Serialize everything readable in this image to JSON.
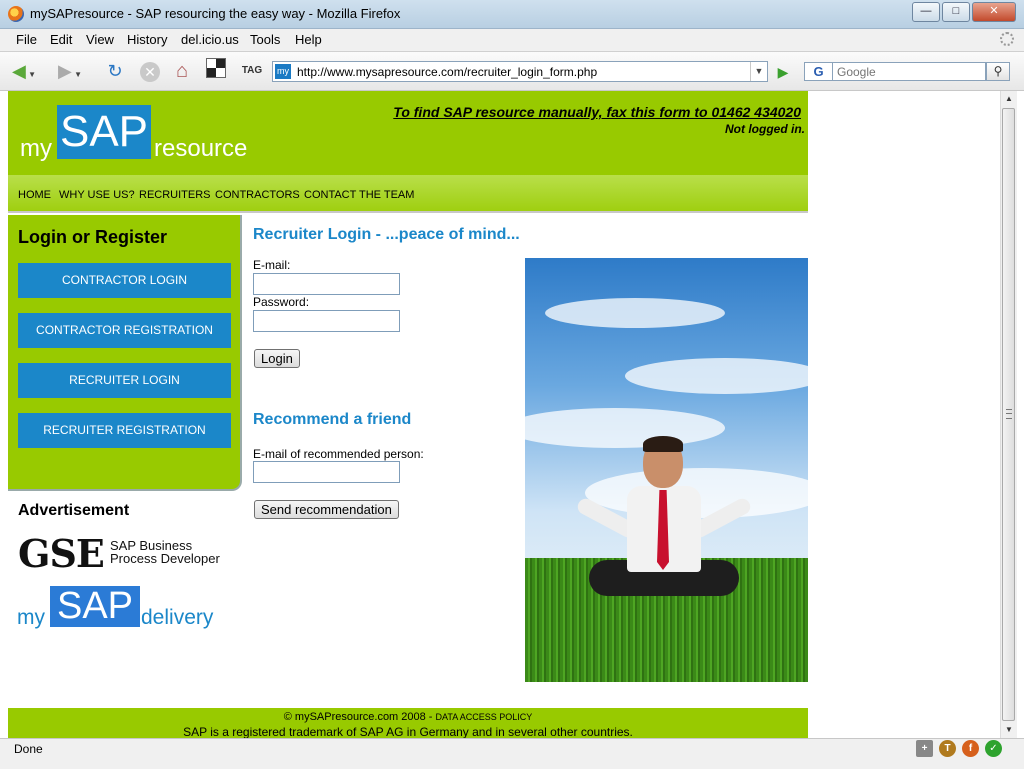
{
  "window": {
    "title": "mySAPresource - SAP resourcing the easy way - Mozilla Firefox",
    "controls": [
      "—",
      "□",
      "✕"
    ]
  },
  "menu": [
    "File",
    "Edit",
    "View",
    "History",
    "del.icio.us",
    "Tools",
    "Help"
  ],
  "toolbar": {
    "tag_label": "TAG",
    "site_icon_text": "my",
    "url": "http://www.mysapresource.com/recruiter_login_form.php",
    "search_engine": "G",
    "search_placeholder": "Google"
  },
  "header": {
    "logo_my": "my",
    "logo_sap": "SAP",
    "logo_resource": "resource",
    "fax_text": "To find SAP resource manually, fax this form to 01462 434020",
    "login_status": "Not logged in."
  },
  "nav": [
    "HOME",
    "WHY USE US?",
    "RECRUITERS",
    "CONTRACTORS",
    "CONTACT THE TEAM"
  ],
  "sidebar": {
    "heading": "Login or Register",
    "buttons": [
      "CONTRACTOR LOGIN",
      "CONTRACTOR REGISTRATION",
      "RECRUITER LOGIN",
      "RECRUITER REGISTRATION"
    ],
    "ad_title": "Advertisement",
    "ad_gse_big": "GSE",
    "ad_gse_line1": "SAP Business",
    "ad_gse_line2": "Process Developer",
    "ad_delivery_my": "my",
    "ad_delivery_sap": "SAP",
    "ad_delivery_word": "delivery"
  },
  "login": {
    "title": "Recruiter Login - ...peace of mind...",
    "email_label": "E-mail:",
    "password_label": "Password:",
    "email_value": "",
    "password_value": "",
    "login_button": "Login"
  },
  "recommend": {
    "title": "Recommend a friend",
    "email_label": "E-mail of recommended person:",
    "email_value": "",
    "send_button": "Send recommendation"
  },
  "footer": {
    "copyright": "© mySAPresource.com 2008 - ",
    "policy": "Data Access Policy",
    "trademark": "SAP is a registered trademark of SAP AG in Germany and in several other countries."
  },
  "status": {
    "text": "Done"
  }
}
